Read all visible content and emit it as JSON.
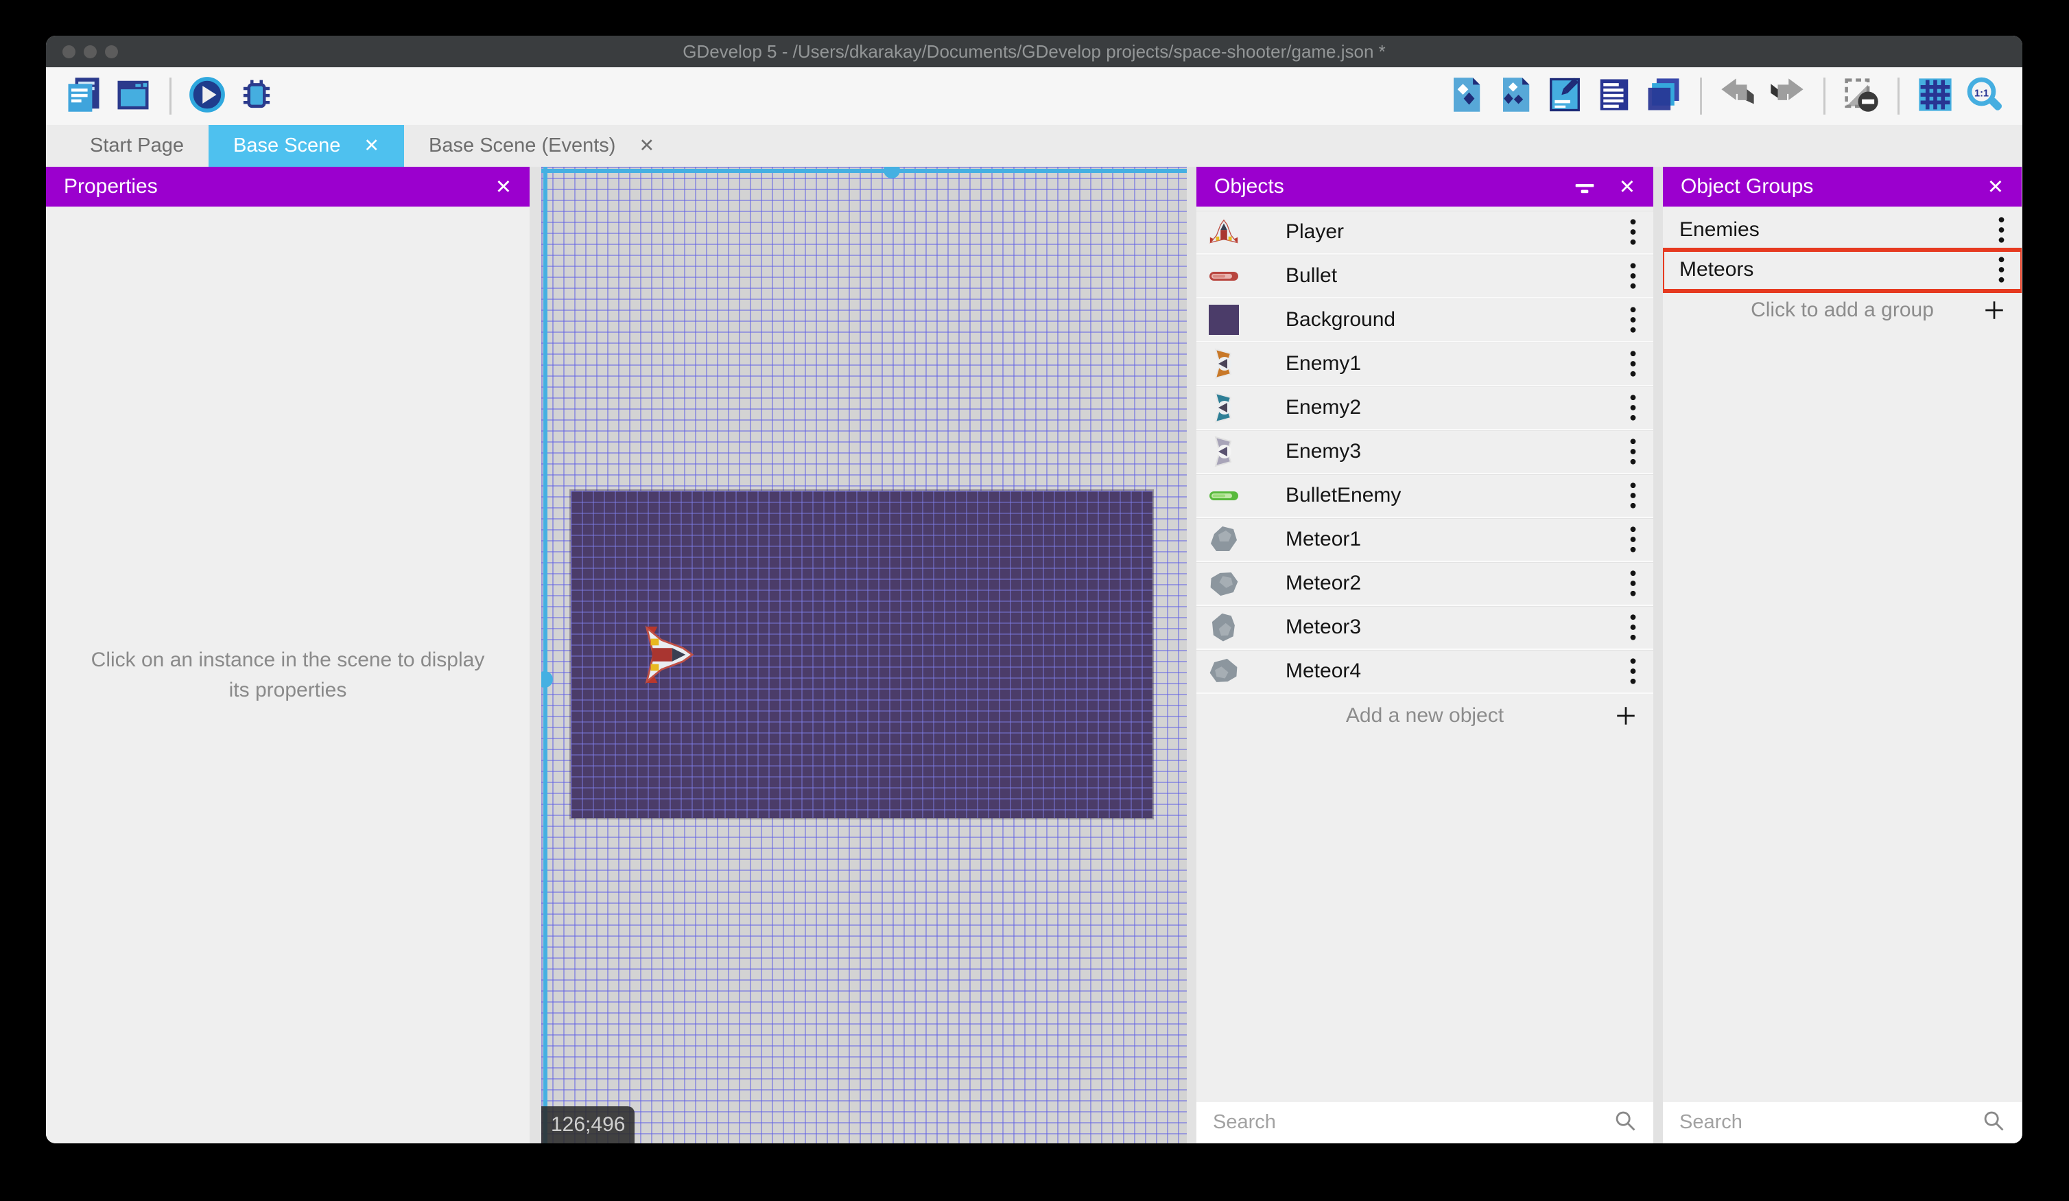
{
  "glyphs": {
    "close": "✕"
  },
  "colors": {
    "accent_purple": "#9b00ce",
    "tab_active_blue": "#4ec1ef",
    "selection_cyan": "#45b0e2",
    "highlight_red": "#e63a20",
    "titlebar_gray": "#3a3d3f"
  },
  "window": {
    "title": "GDevelop 5 - /Users/dkarakay/Documents/GDevelop projects/space-shooter/game.json *",
    "controls": [
      {
        "name": "close-button"
      },
      {
        "name": "minimize-button"
      },
      {
        "name": "zoom-button"
      }
    ]
  },
  "toolbar": {
    "left": [
      {
        "name": "project-manager-button",
        "icon": "project-manager-icon"
      },
      {
        "name": "scene-window-button",
        "icon": "scene-window-icon"
      },
      {
        "name": "separator",
        "separator": true
      },
      {
        "name": "launch-preview-button",
        "icon": "play-icon"
      },
      {
        "name": "debug-button",
        "icon": "debug-icon"
      }
    ],
    "right": [
      {
        "name": "open-objects-panel-button",
        "icon": "objects-panel-icon"
      },
      {
        "name": "open-object-groups-panel-button",
        "icon": "object-groups-panel-icon"
      },
      {
        "name": "open-properties-panel-button",
        "icon": "properties-panel-icon"
      },
      {
        "name": "open-instances-list-button",
        "icon": "instances-list-icon"
      },
      {
        "name": "open-layers-panel-button",
        "icon": "layers-icon"
      },
      {
        "name": "separator",
        "separator": true
      },
      {
        "name": "undo-button",
        "icon": "undo-icon"
      },
      {
        "name": "redo-button",
        "icon": "redo-icon"
      },
      {
        "name": "separator",
        "separator": true
      },
      {
        "name": "delete-instances-button",
        "icon": "remove-instances-icon"
      },
      {
        "name": "separator",
        "separator": true
      },
      {
        "name": "toggle-grid-button",
        "icon": "grid-icon"
      },
      {
        "name": "zoom-original-button",
        "icon": "zoom-1-1-icon"
      }
    ]
  },
  "tabs": [
    {
      "label": "Start Page",
      "name": "tab-start-page",
      "active": false,
      "closable": false
    },
    {
      "label": "Base Scene",
      "name": "tab-base-scene",
      "active": true,
      "closable": true
    },
    {
      "label": "Base Scene (Events)",
      "name": "tab-base-scene-events",
      "active": false,
      "closable": true
    }
  ],
  "properties_panel": {
    "title": "Properties",
    "message": "Click on an instance in the scene to display its properties"
  },
  "canvas": {
    "coordinates": "126;496"
  },
  "objects_panel": {
    "title": "Objects",
    "items": [
      {
        "label": "Player",
        "icon": "player-ship-icon",
        "name": "object-row-player"
      },
      {
        "label": "Bullet",
        "icon": "red-bullet-icon",
        "name": "object-row-bullet"
      },
      {
        "label": "Background",
        "icon": "background-square-icon",
        "name": "object-row-background"
      },
      {
        "label": "Enemy1",
        "icon": "enemy1-ship-icon",
        "name": "object-row-enemy1"
      },
      {
        "label": "Enemy2",
        "icon": "enemy2-ship-icon",
        "name": "object-row-enemy2"
      },
      {
        "label": "Enemy3",
        "icon": "enemy3-ship-icon",
        "name": "object-row-enemy3"
      },
      {
        "label": "BulletEnemy",
        "icon": "green-bullet-icon",
        "name": "object-row-bulletenemy"
      },
      {
        "label": "Meteor1",
        "icon": "meteor1-icon",
        "name": "object-row-meteor1"
      },
      {
        "label": "Meteor2",
        "icon": "meteor2-icon",
        "name": "object-row-meteor2"
      },
      {
        "label": "Meteor3",
        "icon": "meteor3-icon",
        "name": "object-row-meteor3"
      },
      {
        "label": "Meteor4",
        "icon": "meteor4-icon",
        "name": "object-row-meteor4"
      }
    ],
    "add_label": "Add a new object",
    "search_placeholder": "Search"
  },
  "object_groups_panel": {
    "title": "Object Groups",
    "items": [
      {
        "label": "Enemies",
        "name": "group-row-enemies",
        "highlighted": false
      },
      {
        "label": "Meteors",
        "name": "group-row-meteors",
        "highlighted": true
      }
    ],
    "add_label": "Click to add a group",
    "search_placeholder": "Search"
  }
}
